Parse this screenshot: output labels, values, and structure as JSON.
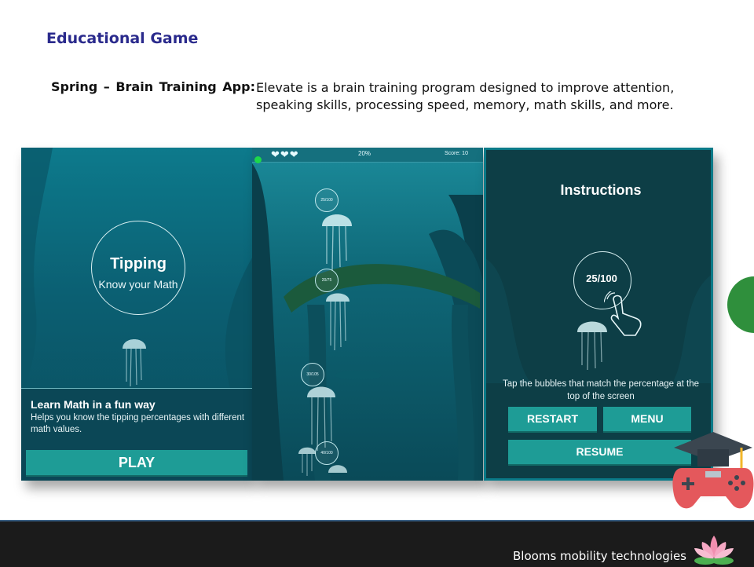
{
  "slide": {
    "title": "Educational Game",
    "app_label": "Spring – Brain Training App:",
    "description": "Elevate is a brain training program designed to improve attention, speaking skills, processing speed, memory, math skills, and more."
  },
  "screen1": {
    "game_title": "Tipping",
    "game_subtitle": "Know your Math",
    "heading": "Learn Math in a fun way",
    "body": "Helps you know the tipping percentages with different math values.",
    "play_label": "PLAY"
  },
  "screen2": {
    "hearts": "❤❤❤",
    "progress": "20%",
    "score": "Score:   10",
    "bubbles": [
      "25/100",
      "20/75",
      "30/105",
      "40/100"
    ]
  },
  "screen3": {
    "title": "Instructions",
    "example_fraction": "25/100",
    "tip": "Tap the bubbles that match the percentage at the top of the screen",
    "restart_label": "RESTART",
    "menu_label": "MENU",
    "resume_label": "RESUME"
  },
  "footer": {
    "company": "Blooms mobility technologies"
  },
  "icons": [
    "game-controller-graduation-icon",
    "lotus-logo-icon",
    "jellyfish-icon",
    "tap-hand-icon",
    "heart-icon"
  ],
  "colors": {
    "title_blue": "#2a2a8c",
    "teal_button": "#1e9c96",
    "footer_bg": "#1b1b1b",
    "accent_green": "#2f8f3c"
  }
}
